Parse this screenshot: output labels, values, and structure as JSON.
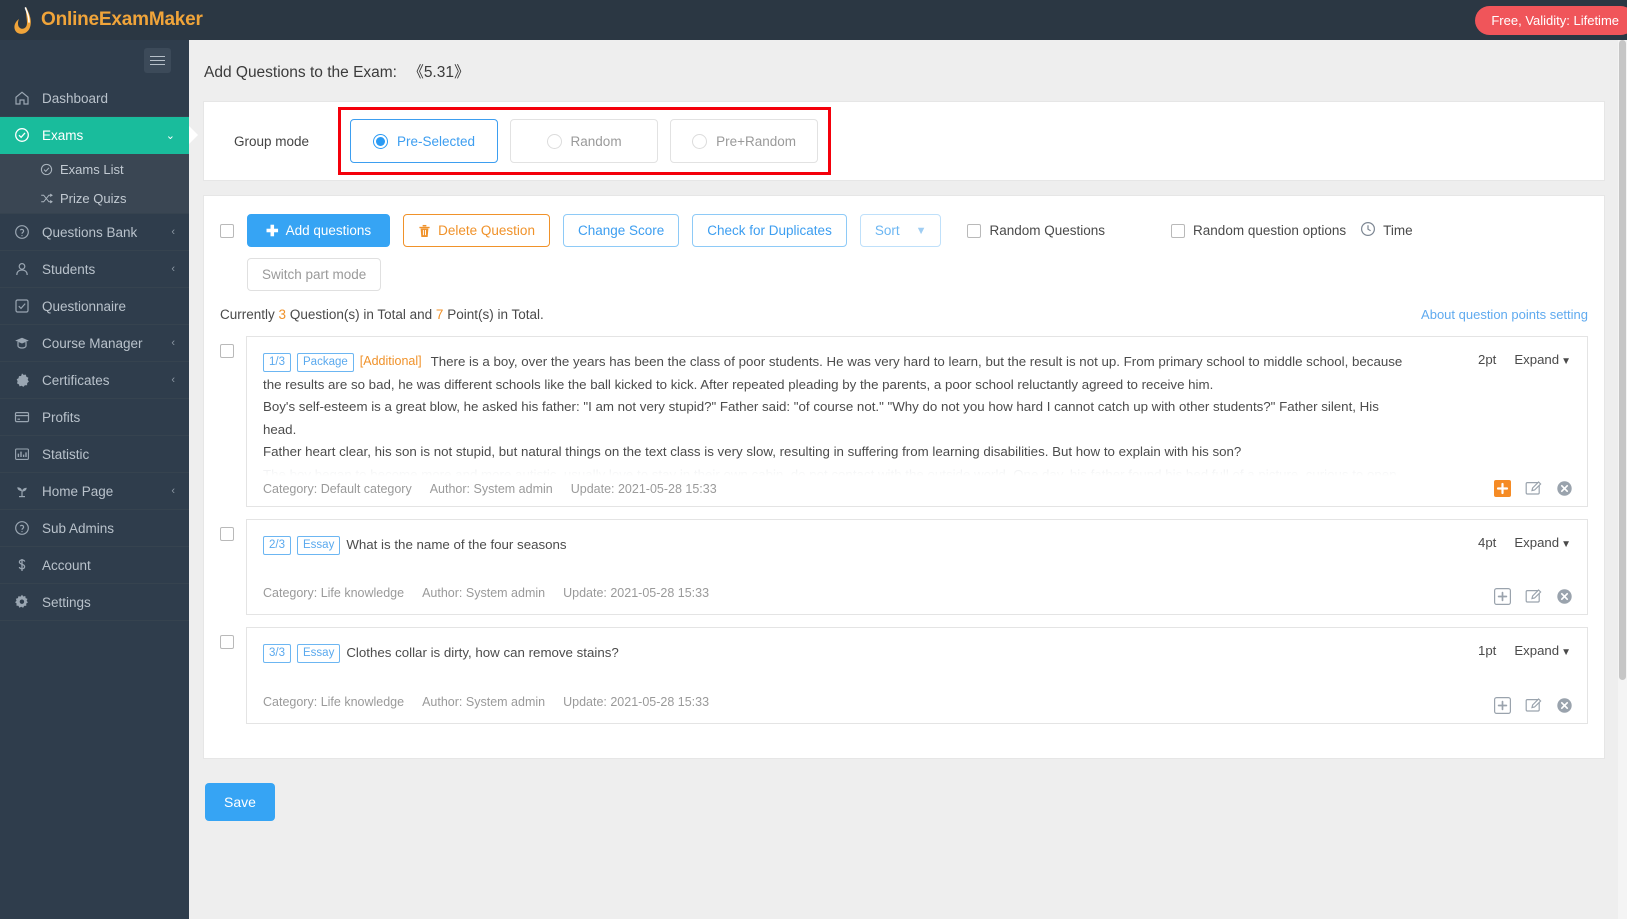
{
  "brand": {
    "name": "OnlineExamMaker"
  },
  "topbar": {
    "plan_badge": "Free, Validity: Lifetime"
  },
  "sidebar": {
    "items": [
      {
        "label": "Dashboard",
        "icon": "home-icon",
        "chevron": "",
        "active": false
      },
      {
        "label": "Exams",
        "icon": "check-circle-icon",
        "chevron": "⌄",
        "active": true
      },
      {
        "label": "Questions Bank",
        "icon": "question-circle-icon",
        "chevron": "‹",
        "active": false
      },
      {
        "label": "Students",
        "icon": "user-icon",
        "chevron": "‹",
        "active": false
      },
      {
        "label": "Questionnaire",
        "icon": "checkbox-icon",
        "chevron": "",
        "active": false
      },
      {
        "label": "Course Manager",
        "icon": "graduation-cap-icon",
        "chevron": "‹",
        "active": false
      },
      {
        "label": "Certificates",
        "icon": "badge-icon",
        "chevron": "‹",
        "active": false
      },
      {
        "label": "Profits",
        "icon": "credit-card-icon",
        "chevron": "",
        "active": false
      },
      {
        "label": "Statistic",
        "icon": "bar-chart-icon",
        "chevron": "",
        "active": false
      },
      {
        "label": "Home Page",
        "icon": "sprout-icon",
        "chevron": "‹",
        "active": false
      },
      {
        "label": "Sub Admins",
        "icon": "question-circle-icon",
        "chevron": "",
        "active": false
      },
      {
        "label": "Account",
        "icon": "dollar-icon",
        "chevron": "",
        "active": false
      },
      {
        "label": "Settings",
        "icon": "gear-icon",
        "chevron": "",
        "active": false
      }
    ],
    "subitems": [
      {
        "label": "Exams List",
        "icon": "check-circle-icon"
      },
      {
        "label": "Prize Quizs",
        "icon": "shuffle-icon"
      }
    ]
  },
  "page": {
    "title_prefix": "Add Questions to the Exam:",
    "exam_name": "《5.31》"
  },
  "group_mode": {
    "label": "Group mode",
    "options": [
      {
        "label": "Pre-Selected",
        "selected": true
      },
      {
        "label": "Random",
        "selected": false
      },
      {
        "label": "Pre+Random",
        "selected": false
      }
    ],
    "highlight_color": "#f4000b"
  },
  "toolbar": {
    "add_questions": "Add questions",
    "delete_question": "Delete Question",
    "change_score": "Change Score",
    "check_duplicates": "Check for Duplicates",
    "sort": "Sort",
    "random_questions": "Random Questions",
    "random_question_options": "Random question options",
    "time": "Time",
    "switch_part_mode": "Switch part mode"
  },
  "summary": {
    "prefix": "Currently",
    "question_count": "3",
    "middle": "Question(s) in Total and",
    "point_count": "7",
    "suffix": "Point(s) in Total.",
    "about_link": "About question points setting"
  },
  "questions": [
    {
      "index": "1/3",
      "type": "Package",
      "additional": "[Additional]",
      "lines": [
        "There is a boy, over the years has been the class of poor students. He was very hard to learn, but the result is not up. From primary school to middle school, because",
        "the results are so bad, he was different schools like the ball kicked to kick. After repeated pleading by the parents, a poor school reluctantly agreed to receive him.",
        "Boy's self-esteem is a great blow, he asked his father: \"I am not very stupid?\" Father said: \"of course not.\" \"Why do not you how hard I cannot catch up with other students?\" Father silent, His",
        "head.",
        "Father heart clear, his son is not stupid, but natural things on the text class is very slow, resulting in suffering from learning disabilities. But how to explain with his son?"
      ],
      "fade_line": "The boy began to become more and more autistic, usually love to stay in their own cabin, do not contact with the outside world. One day, his father found his bed full of a picture, curious to open",
      "points": "2pt",
      "expand": "Expand",
      "category_label": "Category:",
      "category": "Default category",
      "author_label": "Author:",
      "author": "System admin",
      "update_label": "Update:",
      "update": "2021-05-28 15:33",
      "add_icon_active": true
    },
    {
      "index": "2/3",
      "type": "Essay",
      "additional": "",
      "lines": [
        "What is the name of the four seasons"
      ],
      "fade_line": "",
      "points": "4pt",
      "expand": "Expand",
      "category_label": "Category:",
      "category": "Life knowledge",
      "author_label": "Author:",
      "author": "System admin",
      "update_label": "Update:",
      "update": "2021-05-28 15:33",
      "add_icon_active": false
    },
    {
      "index": "3/3",
      "type": "Essay",
      "additional": "",
      "lines": [
        "Clothes collar is dirty, how can remove stains?"
      ],
      "fade_line": "",
      "points": "1pt",
      "expand": "Expand",
      "category_label": "Category:",
      "category": "Life knowledge",
      "author_label": "Author:",
      "author": "System admin",
      "update_label": "Update:",
      "update": "2021-05-28 15:33",
      "add_icon_active": false
    }
  ],
  "footer": {
    "save": "Save"
  },
  "colors": {
    "accent": "#36a4f4",
    "sidebar_bg": "#2f3d4c",
    "active_nav": "#19bc9c",
    "warning": "#f0922a",
    "danger": "#f0555a",
    "highlight_box": "#f4000b"
  }
}
